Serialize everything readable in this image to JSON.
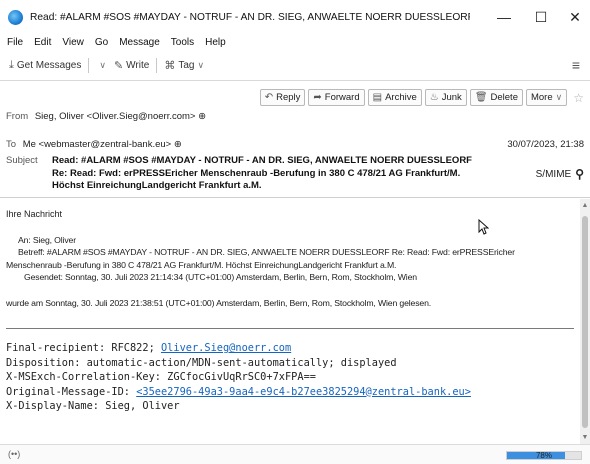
{
  "window": {
    "title": "Read: #ALARM #SOS #MAYDAY - NOTRUF - AN DR. SIEG, ANWAELTE NOERR DUESSLEORF Re: R...",
    "controls": {
      "minimize": "—",
      "maximize": "☐",
      "close": "✕"
    }
  },
  "menu": [
    "File",
    "Edit",
    "View",
    "Go",
    "Message",
    "Tools",
    "Help"
  ],
  "toolbar": {
    "get_messages": "Get Messages",
    "write": "Write",
    "tag": "Tag"
  },
  "actions": {
    "reply": "Reply",
    "forward": "Forward",
    "archive": "Archive",
    "junk": "Junk",
    "delete": "Delete",
    "more": "More"
  },
  "header": {
    "from_label": "From",
    "from_value": "Sieg, Oliver <Oliver.Sieg@noerr.com>",
    "to_label": "To",
    "to_value": "Me <webmaster@zentral-bank.eu>",
    "date": "30/07/2023, 21:38",
    "subject_label": "Subject",
    "subject": "Read: #ALARM #SOS #MAYDAY - NOTRUF - AN DR. SIEG, ANWAELTE NOERR DUESSLEORF Re: Read: Fwd: erPRESSEricher Menschenraub -Berufung in 380 C 478/21 AG Frankfurt/M. Höchst EinreichungLandgericht Frankfurt a.M.",
    "smime": "S/MIME"
  },
  "body": {
    "intro": "Ihre Nachricht",
    "to_line": "An: Sieg, Oliver",
    "subject_line": "Betreff: #ALARM #SOS #MAYDAY - NOTRUF - AN DR. SIEG, ANWAELTE NOERR DUESSLEORF Re: Read: Fwd: erPRESSEricher",
    "subject_line2": "Menschenraub -Berufung in 380 C 478/21 AG Frankfurt/M. Höchst EinreichungLandgericht Frankfurt a.M.",
    "sent_line": "Gesendet: Sonntag, 30. Juli 2023 21:14:34 (UTC+01:00) Amsterdam, Berlin, Bern, Rom, Stockholm, Wien",
    "read_line": "wurde am Sonntag, 30. Juli 2023 21:38:51 (UTC+01:00) Amsterdam, Berlin, Bern, Rom, Stockholm, Wien gelesen.",
    "mdn": {
      "final_recipient_label": "Final-recipient: RFC822; ",
      "final_recipient_link": "Oliver.Sieg@noerr.com",
      "disposition": "Disposition: automatic-action/MDN-sent-automatically; displayed",
      "correlation": "X-MSExch-Correlation-Key: ZGCfocGivUqRrSC0+7xFPA==",
      "orig_id_label": "Original-Message-ID: ",
      "orig_id_link": "<35ee2796-49a3-9aa4-e9c4-b27ee3825294@zentral-bank.eu>",
      "display_name": "X-Display-Name: Sieg, Oliver"
    }
  },
  "status": {
    "connection_icon": "(••)",
    "progress_text": "78%",
    "progress_value": 0.78
  }
}
